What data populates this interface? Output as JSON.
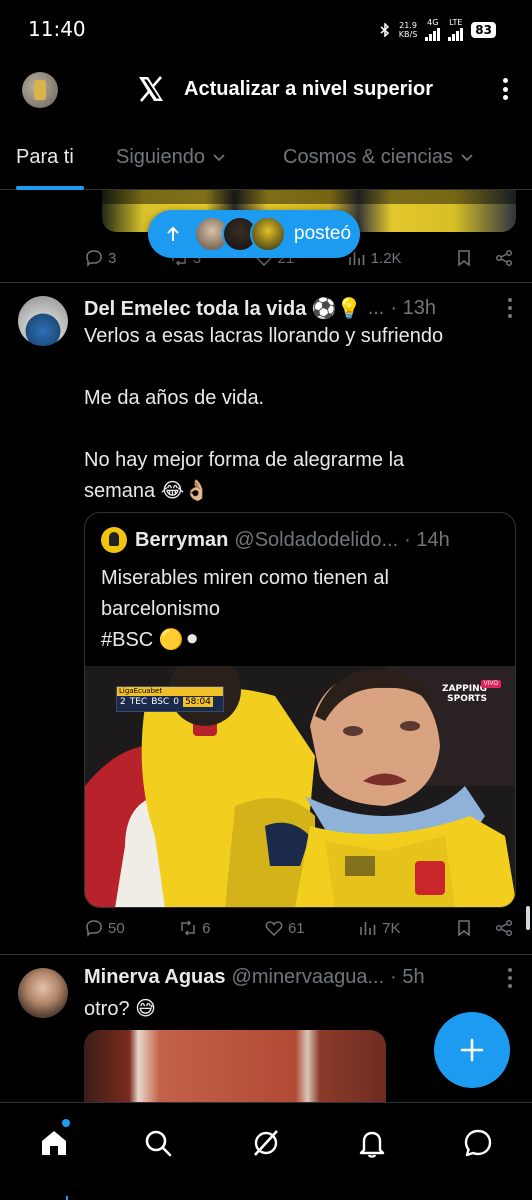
{
  "status_bar": {
    "time": "11:40",
    "net_speed_value": "21.9",
    "net_speed_unit": "KB/S",
    "net_4g": "4G",
    "net_lte": "LTE",
    "battery": "83"
  },
  "header": {
    "title": "Actualizar a nivel superior",
    "logo_icon": "x-logo-icon",
    "menu_icon": "kebab-menu-icon"
  },
  "tabs": [
    {
      "label": "Para ti",
      "active": true
    },
    {
      "label": "Siguiendo",
      "active": false
    },
    {
      "label": "Cosmos & ciencias",
      "active": false
    }
  ],
  "new_posts_pill": {
    "label": "posteó"
  },
  "prev_post": {
    "replies": "3",
    "reposts": "3",
    "likes": "21",
    "views": "1.2K"
  },
  "post2": {
    "name": "Del Emelec toda la vida ⚽💡",
    "handle": "...",
    "time": "· 13h",
    "body": [
      "Verlos a esas lacras llorando y sufriendo",
      "",
      "Me da años de vida.",
      "",
      "No hay mejor forma de alegrarme la",
      "semana 😂👌🏼"
    ],
    "quote": {
      "name": "Berryman",
      "handle": "@Soldadodelido...",
      "time": "· 14h",
      "body": [
        "Miserables miren como tienen al",
        "barcelonismo",
        "#BSC 🟡⚫"
      ],
      "media": {
        "league": "LigaEcuabet",
        "team_home": "TEC",
        "score_home": "2",
        "team_away": "BSC",
        "score_away": "0",
        "clock": "58:04",
        "broadcaster": "ZAPPING",
        "broadcaster_sub": "SPORTS",
        "live_badge": "VIVO"
      }
    },
    "replies": "50",
    "reposts": "6",
    "likes": "61",
    "views": "7K"
  },
  "post3": {
    "name": "Minerva Aguas",
    "handle": "@minervaagua...",
    "time": "· 5h",
    "body": "otro? 😅"
  },
  "colors": {
    "accent": "#1d9bf0",
    "background": "#000000",
    "text_primary": "#e7e9ea",
    "text_secondary": "#71767b",
    "divider": "#2f3336"
  },
  "bottom_nav": [
    {
      "name": "home-icon"
    },
    {
      "name": "search-icon"
    },
    {
      "name": "grok-icon"
    },
    {
      "name": "notifications-icon"
    },
    {
      "name": "messages-icon"
    }
  ]
}
